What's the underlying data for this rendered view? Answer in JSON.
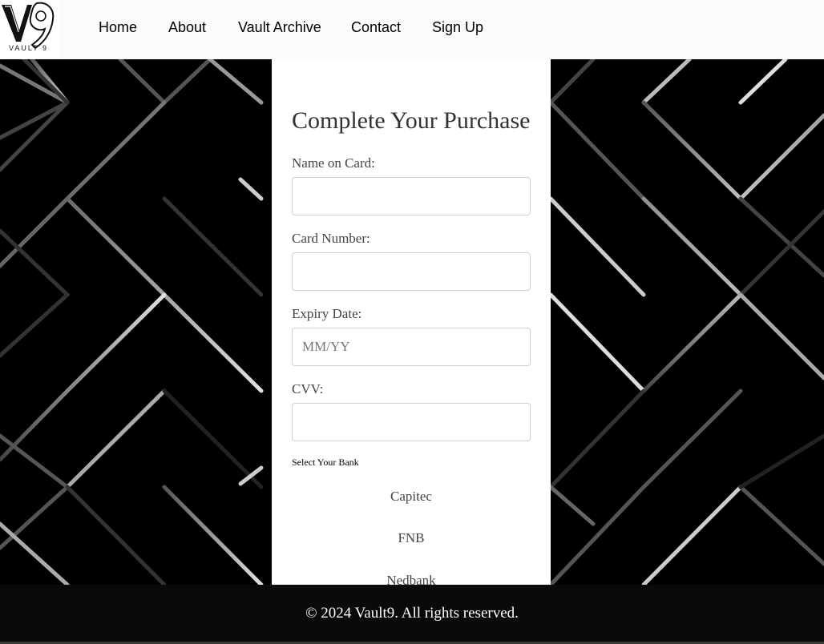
{
  "header": {
    "logo": {
      "mark": "V9",
      "wordmark": "VAULT 9"
    },
    "nav": [
      {
        "label": "Home"
      },
      {
        "label": "About"
      },
      {
        "label": "Vault Archive"
      },
      {
        "label": "Contact"
      },
      {
        "label": "Sign Up"
      }
    ]
  },
  "form": {
    "title": "Complete Your Purchase",
    "fields": [
      {
        "label": "Name on Card:",
        "value": "",
        "placeholder": ""
      },
      {
        "label": "Card Number:",
        "value": "",
        "placeholder": ""
      },
      {
        "label": "Expiry Date:",
        "value": "",
        "placeholder": "MM/YY"
      },
      {
        "label": "CVV:",
        "value": "",
        "placeholder": ""
      }
    ],
    "bank": {
      "heading": "Select Your Bank",
      "options": [
        "Capitec",
        "FNB",
        "Nedbank"
      ]
    }
  },
  "footer": {
    "text": "© 2024 Vault9. All rights reserved."
  },
  "colors": {
    "header_bg": "#fbfbfb",
    "background": "#000000",
    "pattern_line": "#bdbdbd",
    "card_bg": "#ffffff",
    "footer_bg": "#0a0a0a",
    "footer_text": "#ffffff"
  }
}
